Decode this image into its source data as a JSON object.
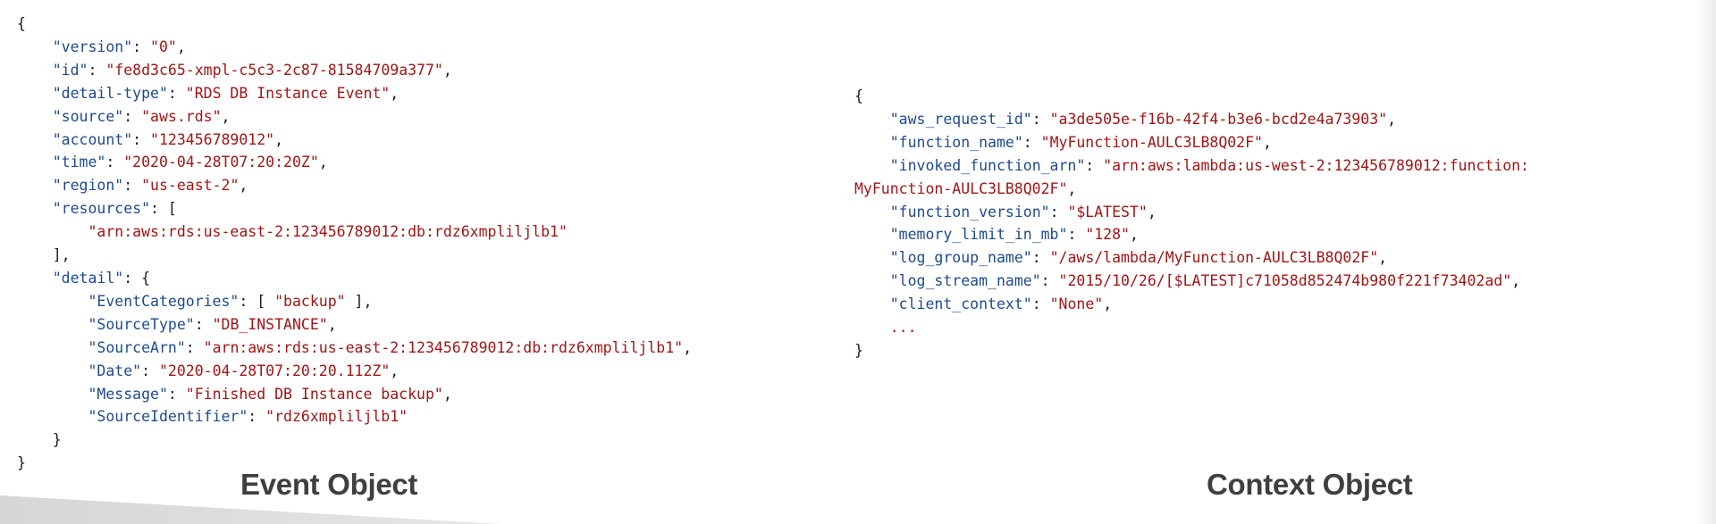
{
  "event_object": {
    "caption": "Event Object",
    "code_lines": [
      [
        {
          "t": "{",
          "c": "p"
        }
      ],
      [
        {
          "t": "    ",
          "c": "p"
        },
        {
          "t": "\"version\"",
          "c": "k"
        },
        {
          "t": ": ",
          "c": "p"
        },
        {
          "t": "\"0\"",
          "c": "s"
        },
        {
          "t": ",",
          "c": "p"
        }
      ],
      [
        {
          "t": "    ",
          "c": "p"
        },
        {
          "t": "\"id\"",
          "c": "k"
        },
        {
          "t": ": ",
          "c": "p"
        },
        {
          "t": "\"fe8d3c65-xmpl-c5c3-2c87-81584709a377\"",
          "c": "s"
        },
        {
          "t": ",",
          "c": "p"
        }
      ],
      [
        {
          "t": "    ",
          "c": "p"
        },
        {
          "t": "\"detail-type\"",
          "c": "k"
        },
        {
          "t": ": ",
          "c": "p"
        },
        {
          "t": "\"RDS DB Instance Event\"",
          "c": "s"
        },
        {
          "t": ",",
          "c": "p"
        }
      ],
      [
        {
          "t": "    ",
          "c": "p"
        },
        {
          "t": "\"source\"",
          "c": "k"
        },
        {
          "t": ": ",
          "c": "p"
        },
        {
          "t": "\"aws.rds\"",
          "c": "s"
        },
        {
          "t": ",",
          "c": "p"
        }
      ],
      [
        {
          "t": "    ",
          "c": "p"
        },
        {
          "t": "\"account\"",
          "c": "k"
        },
        {
          "t": ": ",
          "c": "p"
        },
        {
          "t": "\"123456789012\"",
          "c": "s"
        },
        {
          "t": ",",
          "c": "p"
        }
      ],
      [
        {
          "t": "    ",
          "c": "p"
        },
        {
          "t": "\"time\"",
          "c": "k"
        },
        {
          "t": ": ",
          "c": "p"
        },
        {
          "t": "\"2020-04-28T07:20:20Z\"",
          "c": "s"
        },
        {
          "t": ",",
          "c": "p"
        }
      ],
      [
        {
          "t": "    ",
          "c": "p"
        },
        {
          "t": "\"region\"",
          "c": "k"
        },
        {
          "t": ": ",
          "c": "p"
        },
        {
          "t": "\"us-east-2\"",
          "c": "s"
        },
        {
          "t": ",",
          "c": "p"
        }
      ],
      [
        {
          "t": "    ",
          "c": "p"
        },
        {
          "t": "\"resources\"",
          "c": "k"
        },
        {
          "t": ": [",
          "c": "p"
        }
      ],
      [
        {
          "t": "        ",
          "c": "p"
        },
        {
          "t": "\"arn:aws:rds:us-east-2:123456789012:db:rdz6xmpliljlb1\"",
          "c": "s"
        }
      ],
      [
        {
          "t": "    ],",
          "c": "p"
        }
      ],
      [
        {
          "t": "    ",
          "c": "p"
        },
        {
          "t": "\"detail\"",
          "c": "k"
        },
        {
          "t": ": {",
          "c": "p"
        }
      ],
      [
        {
          "t": "        ",
          "c": "p"
        },
        {
          "t": "\"EventCategories\"",
          "c": "k"
        },
        {
          "t": ": [ ",
          "c": "p"
        },
        {
          "t": "\"backup\"",
          "c": "s"
        },
        {
          "t": " ],",
          "c": "p"
        }
      ],
      [
        {
          "t": "        ",
          "c": "p"
        },
        {
          "t": "\"SourceType\"",
          "c": "k"
        },
        {
          "t": ": ",
          "c": "p"
        },
        {
          "t": "\"DB_INSTANCE\"",
          "c": "s"
        },
        {
          "t": ",",
          "c": "p"
        }
      ],
      [
        {
          "t": "        ",
          "c": "p"
        },
        {
          "t": "\"SourceArn\"",
          "c": "k"
        },
        {
          "t": ": ",
          "c": "p"
        },
        {
          "t": "\"arn:aws:rds:us-east-2:123456789012:db:rdz6xmpliljlb1\"",
          "c": "s"
        },
        {
          "t": ",",
          "c": "p"
        }
      ],
      [
        {
          "t": "        ",
          "c": "p"
        },
        {
          "t": "\"Date\"",
          "c": "k"
        },
        {
          "t": ": ",
          "c": "p"
        },
        {
          "t": "\"2020-04-28T07:20:20.112Z\"",
          "c": "s"
        },
        {
          "t": ",",
          "c": "p"
        }
      ],
      [
        {
          "t": "        ",
          "c": "p"
        },
        {
          "t": "\"Message\"",
          "c": "k"
        },
        {
          "t": ": ",
          "c": "p"
        },
        {
          "t": "\"Finished DB Instance backup\"",
          "c": "s"
        },
        {
          "t": ",",
          "c": "p"
        }
      ],
      [
        {
          "t": "        ",
          "c": "p"
        },
        {
          "t": "\"SourceIdentifier\"",
          "c": "k"
        },
        {
          "t": ": ",
          "c": "p"
        },
        {
          "t": "\"rdz6xmpliljlb1\"",
          "c": "s"
        }
      ],
      [
        {
          "t": "    }",
          "c": "p"
        }
      ],
      [
        {
          "t": "}",
          "c": "p"
        }
      ]
    ]
  },
  "context_object": {
    "caption": "Context Object",
    "code_lines": [
      [
        {
          "t": "{",
          "c": "p"
        }
      ],
      [
        {
          "t": "    ",
          "c": "p"
        },
        {
          "t": "\"aws_request_id\"",
          "c": "k"
        },
        {
          "t": ": ",
          "c": "p"
        },
        {
          "t": "\"a3de505e-f16b-42f4-b3e6-bcd2e4a73903\"",
          "c": "s"
        },
        {
          "t": ",",
          "c": "p"
        }
      ],
      [
        {
          "t": "    ",
          "c": "p"
        },
        {
          "t": "\"function_name\"",
          "c": "k"
        },
        {
          "t": ": ",
          "c": "p"
        },
        {
          "t": "\"MyFunction-AULC3LB8Q02F\"",
          "c": "s"
        },
        {
          "t": ",",
          "c": "p"
        }
      ],
      [
        {
          "t": "    ",
          "c": "p"
        },
        {
          "t": "\"invoked_function_arn\"",
          "c": "k"
        },
        {
          "t": ": ",
          "c": "p"
        },
        {
          "t": "\"arn:aws:lambda:us-west-2:123456789012:function:",
          "c": "s"
        }
      ],
      [
        {
          "t": "MyFunction-AULC3LB8Q02F\"",
          "c": "s"
        },
        {
          "t": ",",
          "c": "p"
        }
      ],
      [
        {
          "t": "    ",
          "c": "p"
        },
        {
          "t": "\"function_version\"",
          "c": "k"
        },
        {
          "t": ": ",
          "c": "p"
        },
        {
          "t": "\"$LATEST\"",
          "c": "s"
        },
        {
          "t": ",",
          "c": "p"
        }
      ],
      [
        {
          "t": "    ",
          "c": "p"
        },
        {
          "t": "\"memory_limit_in_mb\"",
          "c": "k"
        },
        {
          "t": ": ",
          "c": "p"
        },
        {
          "t": "\"128\"",
          "c": "s"
        },
        {
          "t": ",",
          "c": "p"
        }
      ],
      [
        {
          "t": "    ",
          "c": "p"
        },
        {
          "t": "\"log_group_name\"",
          "c": "k"
        },
        {
          "t": ": ",
          "c": "p"
        },
        {
          "t": "\"/aws/lambda/MyFunction-AULC3LB8Q02F\"",
          "c": "s"
        },
        {
          "t": ",",
          "c": "p"
        }
      ],
      [
        {
          "t": "    ",
          "c": "p"
        },
        {
          "t": "\"log_stream_name\"",
          "c": "k"
        },
        {
          "t": ": ",
          "c": "p"
        },
        {
          "t": "\"2015/10/26/[$LATEST]c71058d852474b980f221f73402ad\"",
          "c": "s"
        },
        {
          "t": ",",
          "c": "p"
        }
      ],
      [
        {
          "t": "    ",
          "c": "p"
        },
        {
          "t": "\"client_context\"",
          "c": "k"
        },
        {
          "t": ": ",
          "c": "p"
        },
        {
          "t": "\"None\"",
          "c": "s"
        },
        {
          "t": ",",
          "c": "p"
        }
      ],
      [
        {
          "t": "    ",
          "c": "p"
        },
        {
          "t": "...",
          "c": "s"
        }
      ],
      [
        {
          "t": "}",
          "c": "p"
        }
      ]
    ]
  },
  "colors": {
    "json_key": "#1d4b8f",
    "json_string": "#a31515",
    "punctuation": "#1a1a1a",
    "caption": "#3f3f3f",
    "background": "#ffffff"
  }
}
